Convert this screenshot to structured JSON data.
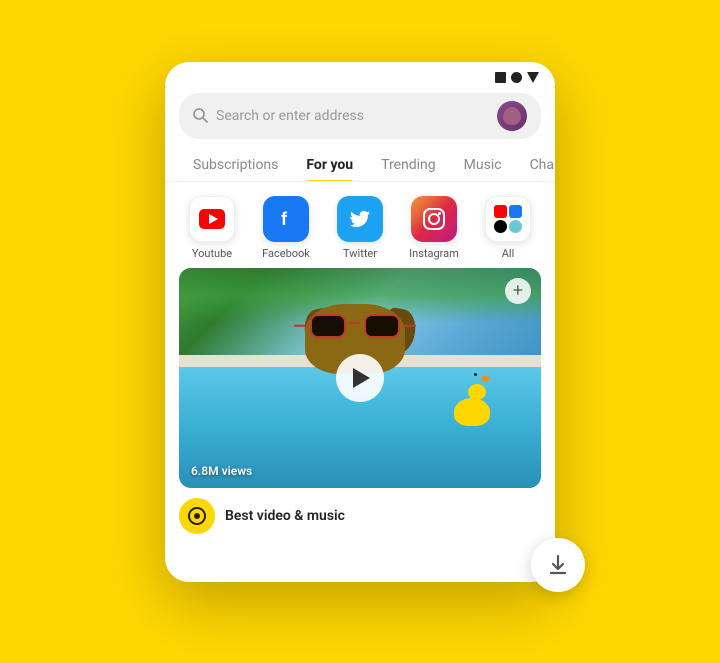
{
  "background": {
    "color": "#FFD700"
  },
  "status_bar": {
    "icons": [
      "square",
      "circle",
      "triangle"
    ]
  },
  "search_bar": {
    "placeholder": "Search or enter address"
  },
  "nav_tabs": [
    {
      "id": "subscriptions",
      "label": "Subscriptions",
      "active": false
    },
    {
      "id": "for-you",
      "label": "For you",
      "active": true
    },
    {
      "id": "trending",
      "label": "Trending",
      "active": false
    },
    {
      "id": "music",
      "label": "Music",
      "active": false
    },
    {
      "id": "chan",
      "label": "Chan",
      "active": false
    }
  ],
  "social_apps": [
    {
      "id": "youtube",
      "label": "Youtube",
      "color": "#fff",
      "icon": "YT"
    },
    {
      "id": "facebook",
      "label": "Facebook",
      "color": "#1877F2",
      "icon": "f"
    },
    {
      "id": "twitter",
      "label": "Twitter",
      "color": "#1DA1F2",
      "icon": "t"
    },
    {
      "id": "instagram",
      "label": "Instagram",
      "color": "gradient",
      "icon": "ig"
    },
    {
      "id": "all",
      "label": "All",
      "color": "#fff",
      "icon": "all"
    }
  ],
  "video": {
    "views": "6.8M views",
    "plus_label": "+",
    "play_button_visible": true
  },
  "bottom_bar": {
    "title": "Best video & music"
  },
  "download_button": {
    "label": "Download"
  }
}
